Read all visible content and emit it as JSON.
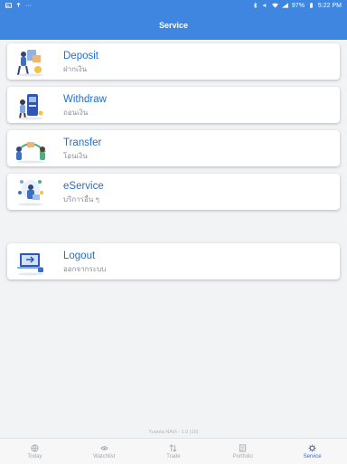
{
  "status_bar": {
    "battery": "97%",
    "time": "5:22 PM",
    "dots": "···"
  },
  "header": {
    "title": "Service"
  },
  "menu": [
    {
      "title": "Deposit",
      "subtitle": "ฝากเงิน",
      "illustration": "deposit-illustration"
    },
    {
      "title": "Withdraw",
      "subtitle": "ถอนเงิน",
      "illustration": "withdraw-illustration"
    },
    {
      "title": "Transfer",
      "subtitle": "โอนเงิน",
      "illustration": "transfer-illustration"
    },
    {
      "title": "eService",
      "subtitle": "บริการอื่น ๆ",
      "illustration": "eservice-illustration"
    }
  ],
  "logout": {
    "title": "Logout",
    "subtitle": "ออกจากระบบ",
    "illustration": "logout-illustration"
  },
  "version": "Yuanta NAVI - 1.0 (15)",
  "tabs": [
    {
      "label": "Today",
      "icon": "globe-icon",
      "active": false
    },
    {
      "label": "Watchlist",
      "icon": "eye-icon",
      "active": false
    },
    {
      "label": "Trade",
      "icon": "trade-icon",
      "active": false
    },
    {
      "label": "Portfolio",
      "icon": "portfolio-icon",
      "active": false
    },
    {
      "label": "Service",
      "icon": "gear-icon",
      "active": true
    }
  ],
  "colors": {
    "primary": "#3f86e0",
    "title": "#1f6fd1",
    "active_tab": "#2d6fd0"
  }
}
